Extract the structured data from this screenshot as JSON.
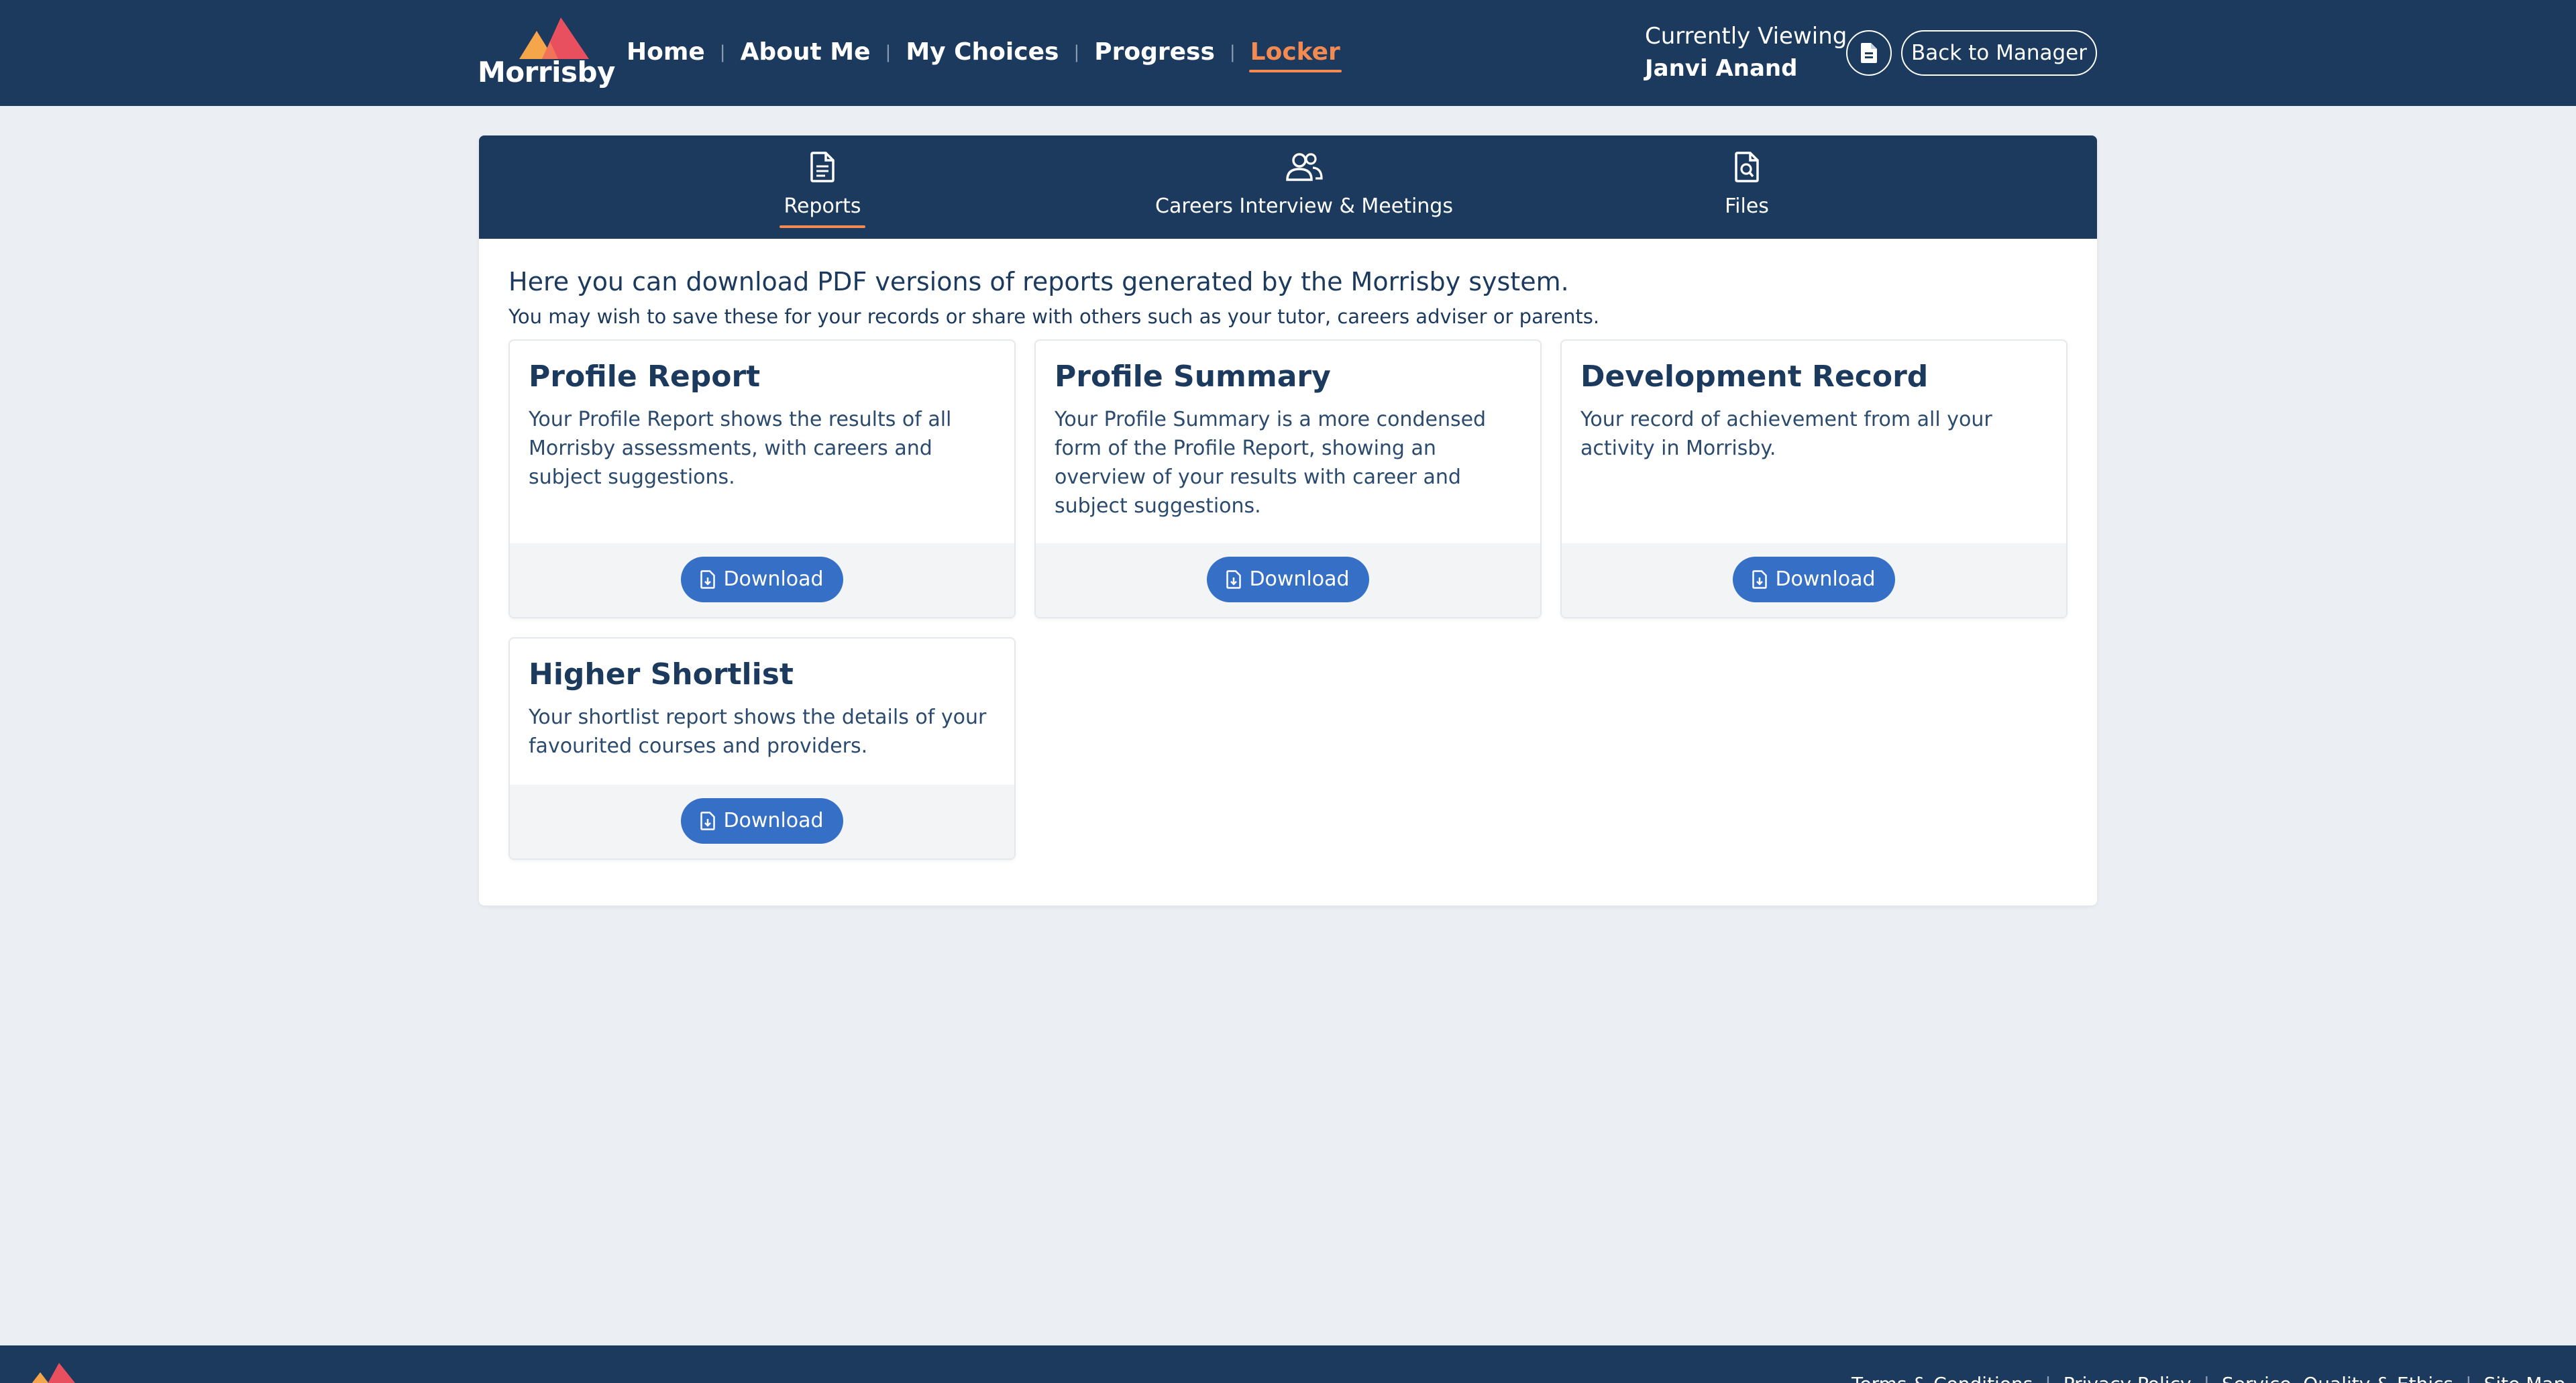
{
  "brand": {
    "name": "Morrisby"
  },
  "nav": {
    "items": [
      {
        "label": "Home"
      },
      {
        "label": "About Me"
      },
      {
        "label": "My Choices"
      },
      {
        "label": "Progress"
      },
      {
        "label": "Locker"
      }
    ],
    "active": "Locker"
  },
  "viewing": {
    "label": "Currently Viewing",
    "name": "Janvi Anand"
  },
  "header_actions": {
    "doc_icon": "document-icon",
    "back_label": "Back to Manager"
  },
  "tabs": [
    {
      "label": "Reports",
      "icon": "report-icon",
      "active": true
    },
    {
      "label": "Careers Interview & Meetings",
      "icon": "people-icon",
      "active": false
    },
    {
      "label": "Files",
      "icon": "file-search-icon",
      "active": false
    }
  ],
  "intro": {
    "line1": "Here you can download PDF versions of reports generated by the Morrisby system.",
    "line2": "You may wish to save these for your records or share with others such as your tutor, careers adviser or parents."
  },
  "cards": [
    {
      "title": "Profile Report",
      "description": "Your Profile Report shows the results of all Morrisby assessments, with careers and subject suggestions.",
      "button": "Download"
    },
    {
      "title": "Profile Summary",
      "description": "Your Profile Summary is a more condensed form of the Profile Report, showing an overview of your results with career and subject suggestions.",
      "button": "Download"
    },
    {
      "title": "Development Record",
      "description": "Your record of achievement from all your activity in Morrisby.",
      "button": "Download"
    },
    {
      "title": "Higher Shortlist",
      "description": "Your shortlist report shows the details of your favourited courses and providers.",
      "button": "Download"
    }
  ],
  "footer": {
    "links": [
      {
        "label": "Terms & Conditions"
      },
      {
        "label": "Privacy Policy"
      },
      {
        "label": "Service, Quality & Ethics"
      },
      {
        "label": "Site Map"
      }
    ]
  },
  "colors": {
    "navy": "#1b3a5e",
    "accent_orange": "#f28a52",
    "button_blue": "#3570c6",
    "page_bg": "#ebeff3"
  }
}
